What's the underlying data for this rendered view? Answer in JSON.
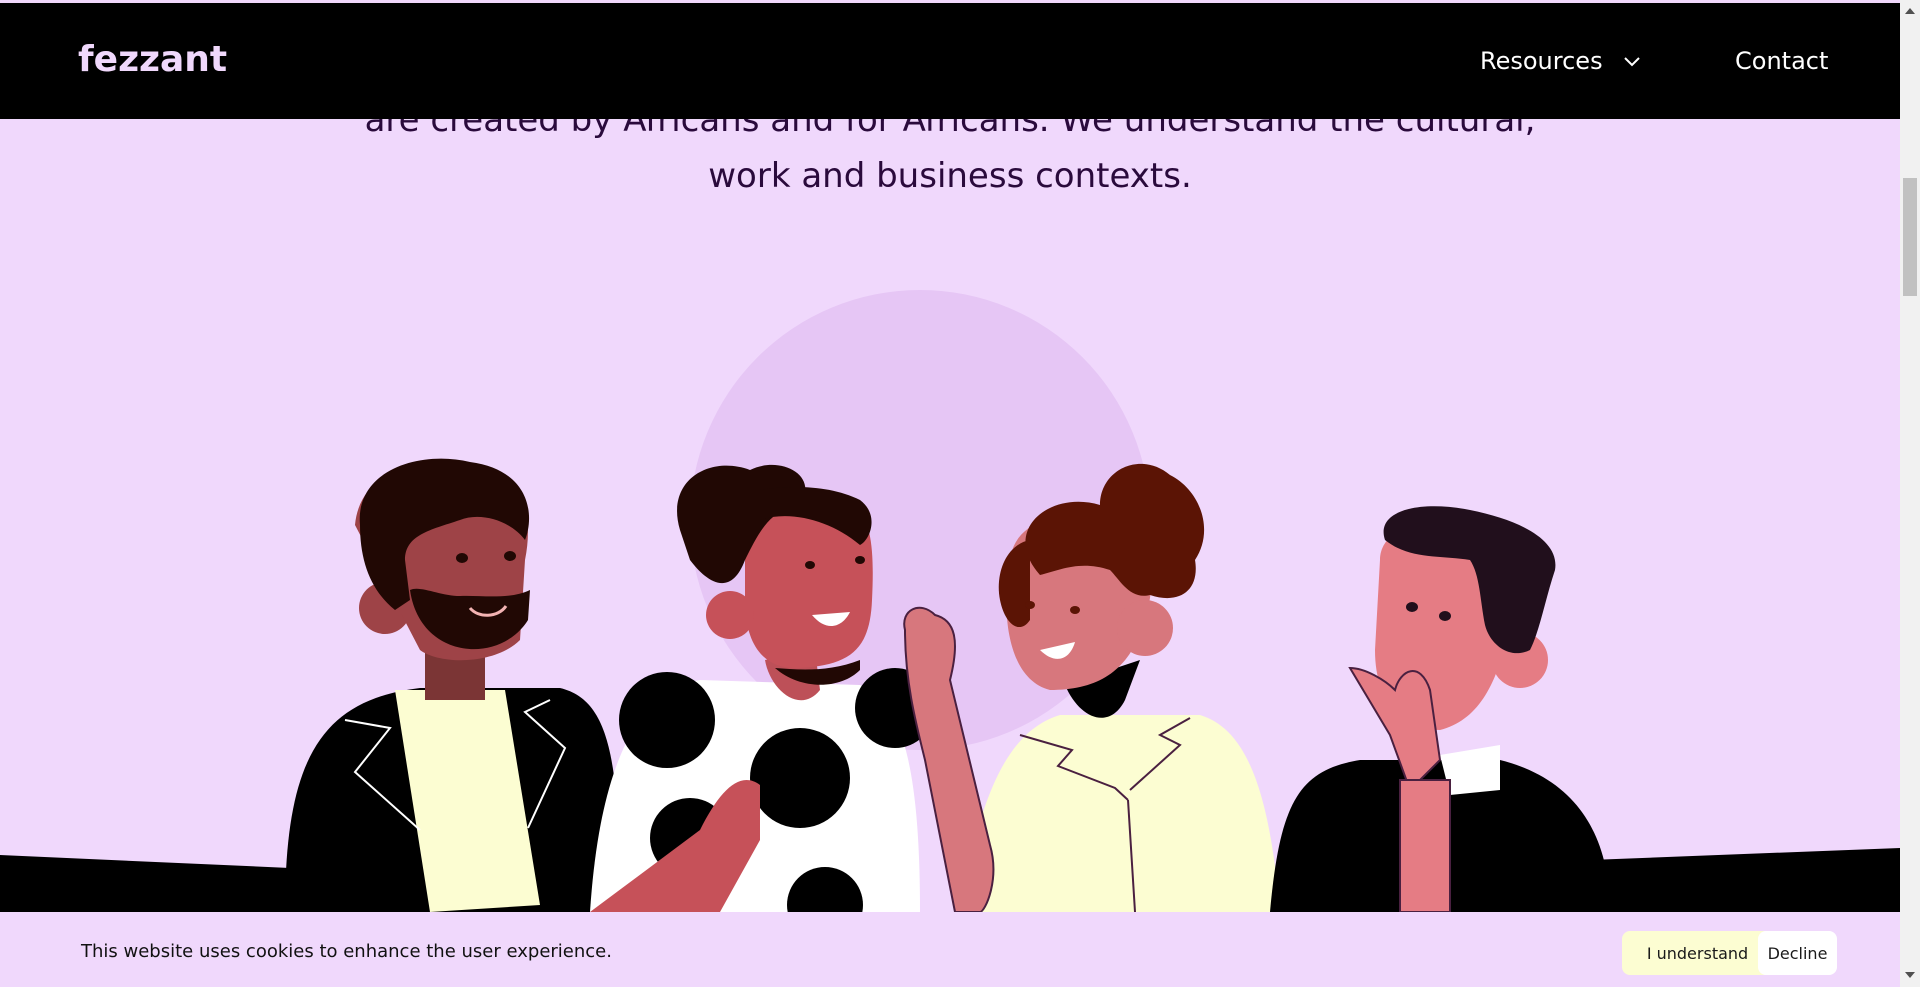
{
  "header": {
    "logo_text": "fezzant",
    "nav": {
      "resources_label": "Resources",
      "contact_label": "Contact"
    }
  },
  "hero": {
    "line1": "are created by Africans and for Africans. We understand the cultural,",
    "line2": "work and business contexts."
  },
  "cookie_banner": {
    "message": "This website uses cookies to enhance the user experience.",
    "accept_label": "I understand",
    "decline_label": "Decline"
  },
  "colors": {
    "background": "#f0d8fc",
    "navbar": "#000000",
    "accent_cream": "#fcfdd2",
    "text_dark": "#2a0a3c"
  }
}
